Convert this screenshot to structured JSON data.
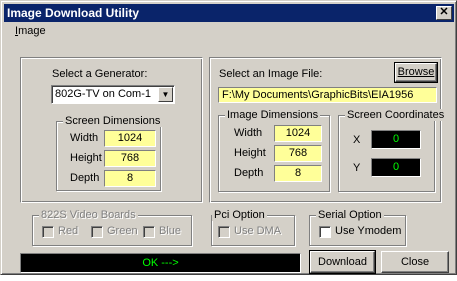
{
  "window": {
    "title": "Image Download Utility",
    "close_glyph": "✕"
  },
  "menu": {
    "items": [
      "Image"
    ]
  },
  "generator": {
    "label": "Select a Generator:",
    "selected": "802G-TV on Com-1",
    "screen_dimensions": {
      "title": "Screen Dimensions",
      "width_label": "Width",
      "width": "1024",
      "height_label": "Height",
      "height": "768",
      "depth_label": "Depth",
      "depth": "8"
    }
  },
  "image_file": {
    "label": "Select an Image File:",
    "browse_label": "Browse",
    "path": "F:\\My Documents\\GraphicBits\\EIA1956",
    "image_dimensions": {
      "title": "Image Dimensions",
      "width_label": "Width",
      "width": "1024",
      "height_label": "Height",
      "height": "768",
      "depth_label": "Depth",
      "depth": "8"
    },
    "screen_coordinates": {
      "title": "Screen Coordinates",
      "x_label": "X",
      "x": "0",
      "y_label": "Y",
      "y": "0"
    }
  },
  "video_boards": {
    "title": "822S Video Boards",
    "red": "Red",
    "green": "Green",
    "blue": "Blue"
  },
  "pci": {
    "title": "Pci Option",
    "use_dma": "Use DMA"
  },
  "serial": {
    "title": "Serial Option",
    "use_ymodem": "Use Ymodem"
  },
  "status": {
    "text": "OK --->"
  },
  "buttons": {
    "download": "Download",
    "close": "Close"
  },
  "colors": {
    "titlebar": "#0a246a",
    "face": "#d4d0c8",
    "field_yellow": "#ffff99",
    "status_green": "#00ff00"
  }
}
